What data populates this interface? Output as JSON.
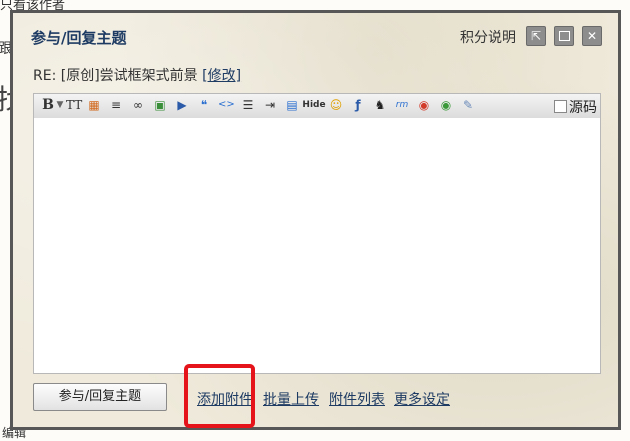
{
  "background": {
    "top_text": "只看该作者",
    "left_char_1": "跟",
    "left_char_2": "找",
    "bottom_text": "编辑"
  },
  "dialog": {
    "title": "参与/回复主题",
    "help_link": "积分说明",
    "subject_prefix": "RE: [原创]尝试框架式前景",
    "subject_edit": "[修改]",
    "window_buttons": [
      "popout-icon",
      "maximize-icon",
      "close-icon"
    ]
  },
  "toolbar": {
    "items": [
      {
        "name": "bold-button",
        "glyph": "B"
      },
      {
        "name": "font-size-button",
        "glyph": "TT"
      },
      {
        "name": "text-color-button",
        "glyph": "▦"
      },
      {
        "name": "align-button",
        "glyph": "≡"
      },
      {
        "name": "link-button",
        "glyph": "∞"
      },
      {
        "name": "image-button",
        "glyph": "▣"
      },
      {
        "name": "media-button",
        "glyph": "▶"
      },
      {
        "name": "quote-button",
        "glyph": "❝"
      },
      {
        "name": "code-button",
        "glyph": "<>"
      },
      {
        "name": "ordered-list-button",
        "glyph": "☰"
      },
      {
        "name": "indent-button",
        "glyph": "⇥"
      },
      {
        "name": "table-button",
        "glyph": "▤"
      },
      {
        "name": "hide-button",
        "glyph": "Hide"
      },
      {
        "name": "smiley-button",
        "glyph": "☺"
      },
      {
        "name": "flash-button",
        "glyph": "ƒ"
      },
      {
        "name": "qq-button",
        "glyph": "♞"
      },
      {
        "name": "rm-button",
        "glyph": "rm"
      },
      {
        "name": "wmv-button",
        "glyph": "◉"
      },
      {
        "name": "wma-button",
        "glyph": "◉"
      },
      {
        "name": "tools-button",
        "glyph": "✎"
      }
    ],
    "source_label": "源码"
  },
  "editor": {
    "value": ""
  },
  "footer": {
    "submit_label": "参与/回复主题",
    "add_attachment": "添加附件",
    "batch_upload": "批量上传",
    "attachment_list": "附件列表",
    "more_settings": "更多设定"
  },
  "colors": {
    "title_blue": "#1e3b63",
    "highlight_red": "#e5141a",
    "dialog_border": "#575757"
  }
}
